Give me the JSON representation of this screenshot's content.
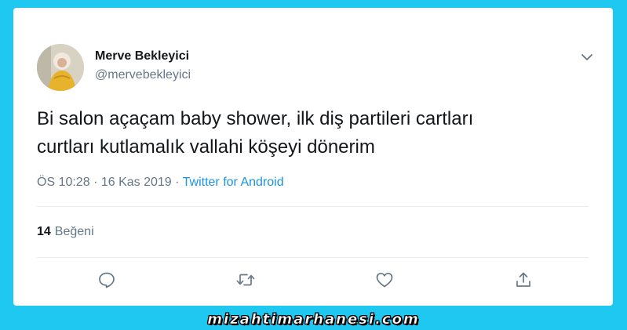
{
  "tweet": {
    "author_name": "Merve Bekleyici",
    "author_handle": "@mervebekleyici",
    "text_lines": [
      "Bi salon açaçam baby shower, ilk diş partileri cartları",
      "curtları kutlamalık vallahi köşeyi dönerim"
    ],
    "time": "ÖS 10:28",
    "separator": "·",
    "date": "16 Kas 2019",
    "source": "Twitter for Android",
    "like_count": "14",
    "like_label": "Beğeni"
  },
  "icons": {
    "chevron": "chevron-down-icon",
    "reply": "reply-icon",
    "retweet": "retweet-icon",
    "like": "heart-icon",
    "share": "share-icon"
  },
  "colors": {
    "background": "#1ec8f0",
    "card": "#ffffff",
    "text_primary": "#14171a",
    "text_secondary": "#657786",
    "link": "#1b95e0",
    "divider": "#e6ecf0"
  },
  "watermark": "mizahtimarhanesi.com"
}
